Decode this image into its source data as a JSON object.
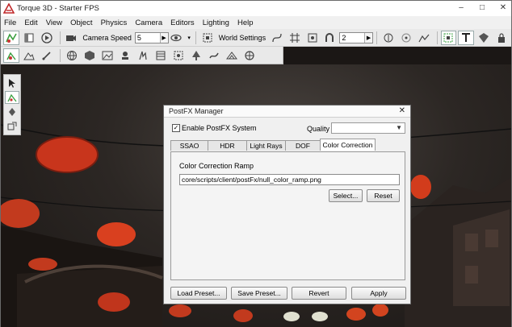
{
  "app": {
    "title": "Torque 3D - Starter FPS"
  },
  "menu": [
    "File",
    "Edit",
    "View",
    "Object",
    "Physics",
    "Camera",
    "Editors",
    "Lighting",
    "Help"
  ],
  "toolbar": {
    "camera_speed_label": "Camera Speed",
    "camera_speed_value": "5",
    "world_settings_label": "World Settings",
    "grid_value": "2"
  },
  "dialog": {
    "title": "PostFX Manager",
    "enable_label": "Enable PostFX System",
    "enable_checked": "✓",
    "quality_label": "Quality",
    "quality_value": "",
    "tabs": [
      "SSAO",
      "HDR",
      "Light Rays",
      "DOF",
      "Color Correction"
    ],
    "active_tab": "Color Correction",
    "ramp_label": "Color Correction Ramp",
    "ramp_path": "core/scripts/client/postFx/null_color_ramp.png",
    "select_button": "Select...",
    "reset_button": "Reset",
    "load_preset": "Load Preset...",
    "save_preset": "Save Preset...",
    "revert": "Revert",
    "apply": "Apply"
  },
  "colors": {
    "accent_green": "#3aa040",
    "lantern_red": "#c8351c"
  }
}
